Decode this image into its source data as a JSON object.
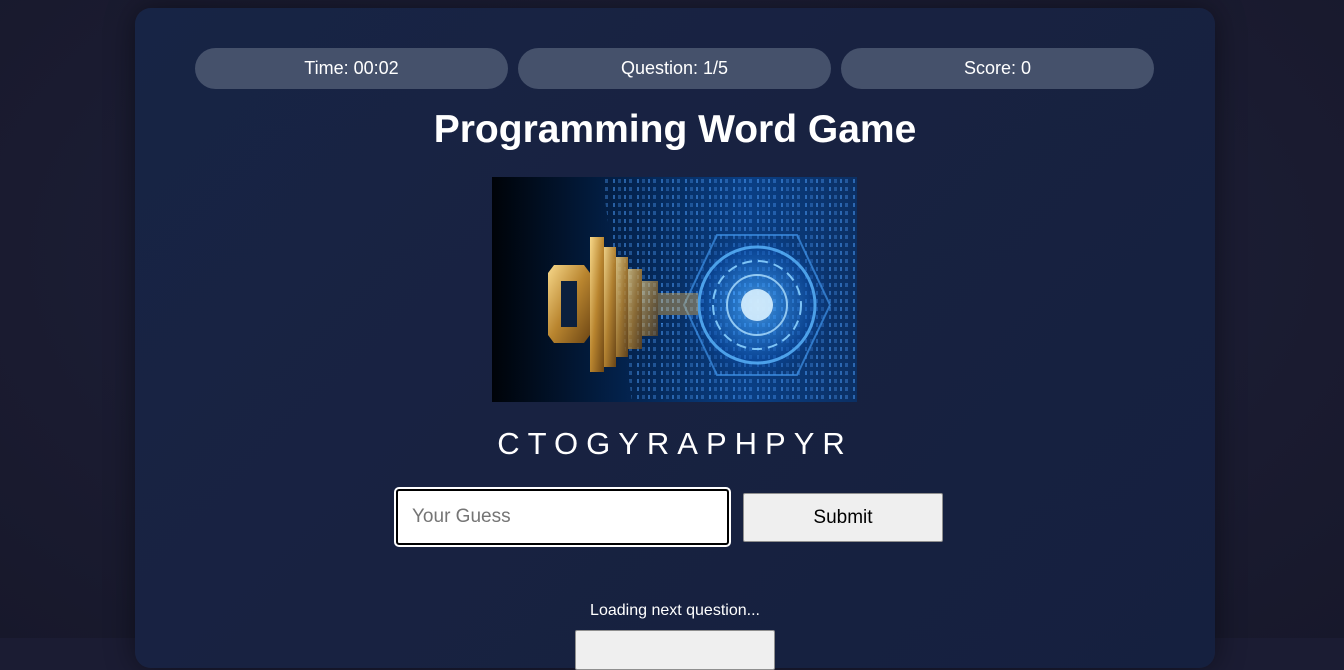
{
  "stats": {
    "time": "Time: 00:02",
    "question": "Question: 1/5",
    "score": "Score: 0"
  },
  "game": {
    "title": "Programming Word Game",
    "scrambled_word": "CTOGYRAPHPYR",
    "image_icon": "digital-key-icon"
  },
  "guess": {
    "placeholder": "Your Guess",
    "value": ""
  },
  "actions": {
    "submit_label": "Submit",
    "next_label": ""
  },
  "status": {
    "loading": "Loading next question..."
  },
  "colors": {
    "pill_bg": "#45516b",
    "card_bg": "#172445",
    "page_bg": "#1b1c33"
  }
}
